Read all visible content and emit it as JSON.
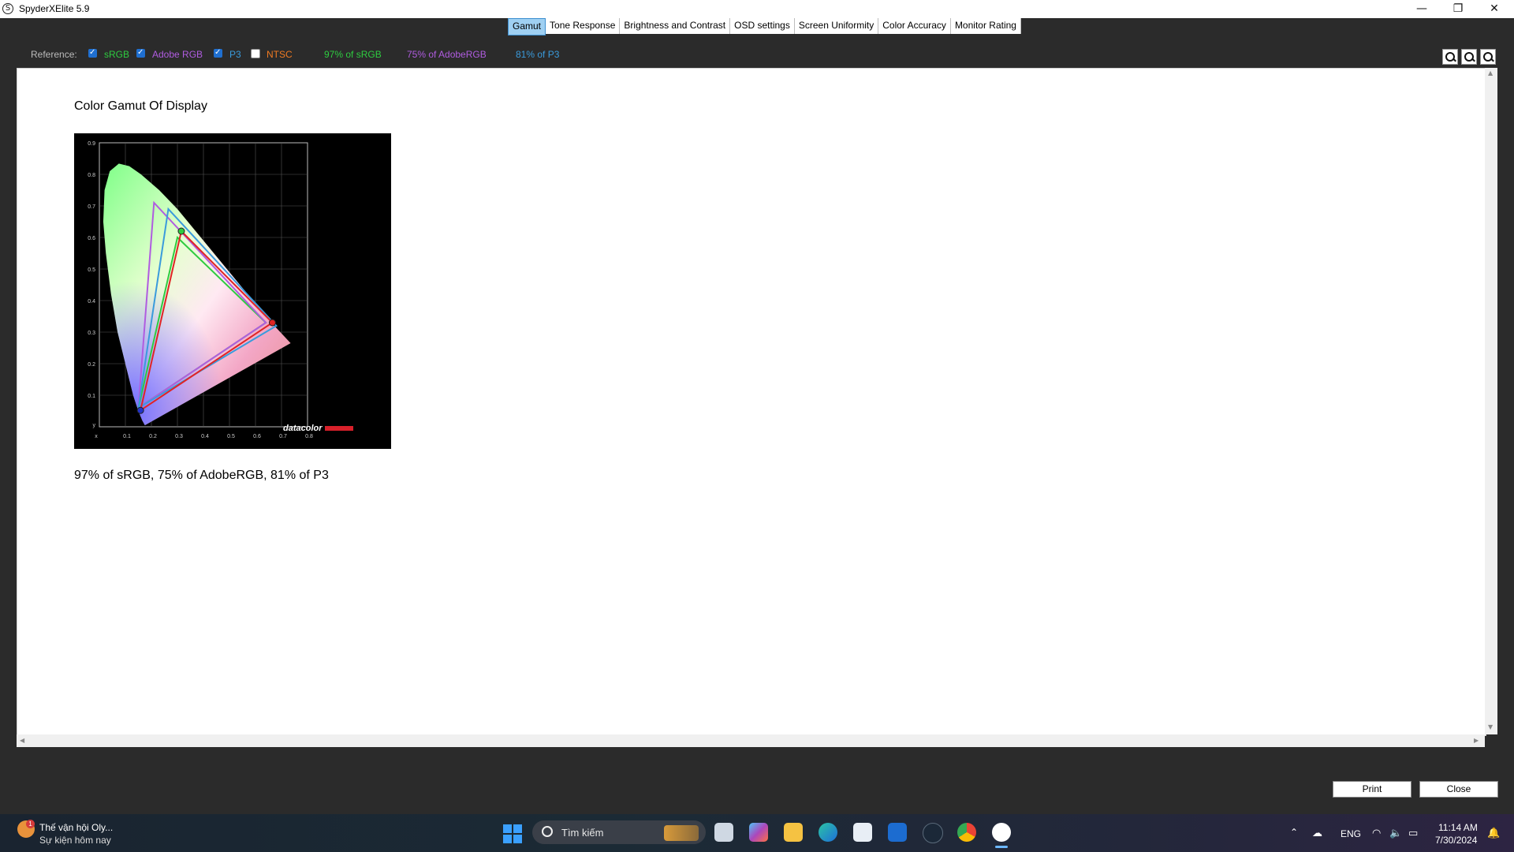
{
  "window": {
    "title": "SpyderXElite 5.9",
    "icon_glyph": "S",
    "controls": {
      "minimize": "—",
      "maximize": "❐",
      "close": "✕"
    }
  },
  "tabs": [
    {
      "label": "Gamut",
      "active": true
    },
    {
      "label": "Tone Response"
    },
    {
      "label": "Brightness and Contrast"
    },
    {
      "label": "OSD settings"
    },
    {
      "label": "Screen Uniformity"
    },
    {
      "label": "Color Accuracy"
    },
    {
      "label": "Monitor Rating"
    }
  ],
  "reference": {
    "label": "Reference:",
    "options": [
      {
        "label": "sRGB",
        "checked": true,
        "color": "#2ecc40"
      },
      {
        "label": "Adobe RGB",
        "checked": true,
        "color": "#b05ce0"
      },
      {
        "label": "P3",
        "checked": true,
        "color": "#3a9bdc"
      },
      {
        "label": "NTSC",
        "checked": false,
        "color": "#f07a22"
      }
    ],
    "stats": [
      {
        "text": "97% of sRGB",
        "color": "#2ecc40"
      },
      {
        "text": "75% of AdobeRGB",
        "color": "#b05ce0"
      },
      {
        "text": "81% of P3",
        "color": "#3a9bdc"
      }
    ]
  },
  "report": {
    "title": "Color Gamut Of Display",
    "summary": "97% of sRGB, 75% of AdobeRGB, 81% of P3"
  },
  "chart_data": {
    "type": "scatter",
    "x_ticks": [
      "x",
      "0.1",
      "0.2",
      "0.3",
      "0.4",
      "0.5",
      "0.6",
      "0.7",
      "0.8"
    ],
    "y_ticks": [
      "y",
      "0.1",
      "0.2",
      "0.3",
      "0.4",
      "0.5",
      "0.6",
      "0.7",
      "0.8",
      "0.9"
    ],
    "xlim": [
      0,
      0.8
    ],
    "ylim": [
      0,
      0.9
    ],
    "grid": true,
    "logo": "datacolor",
    "gamuts": [
      {
        "name": "sRGB",
        "color": "#2ecc40",
        "points": [
          [
            0.64,
            0.33
          ],
          [
            0.3,
            0.6
          ],
          [
            0.15,
            0.06
          ]
        ]
      },
      {
        "name": "Adobe RGB",
        "color": "#b05ce0",
        "points": [
          [
            0.64,
            0.33
          ],
          [
            0.21,
            0.71
          ],
          [
            0.15,
            0.06
          ]
        ]
      },
      {
        "name": "P3",
        "color": "#3a9bdc",
        "points": [
          [
            0.68,
            0.32
          ],
          [
            0.265,
            0.69
          ],
          [
            0.15,
            0.06
          ]
        ]
      },
      {
        "name": "Display",
        "color": "#e02424",
        "points": [
          [
            0.665,
            0.33
          ],
          [
            0.315,
            0.62
          ],
          [
            0.158,
            0.052
          ]
        ]
      }
    ],
    "locus": [
      [
        0.175,
        0.005
      ],
      [
        0.165,
        0.02
      ],
      [
        0.15,
        0.05
      ],
      [
        0.13,
        0.1
      ],
      [
        0.1,
        0.2
      ],
      [
        0.07,
        0.3
      ],
      [
        0.045,
        0.42
      ],
      [
        0.025,
        0.55
      ],
      [
        0.015,
        0.65
      ],
      [
        0.02,
        0.75
      ],
      [
        0.04,
        0.81
      ],
      [
        0.075,
        0.834
      ],
      [
        0.115,
        0.826
      ],
      [
        0.16,
        0.8
      ],
      [
        0.23,
        0.75
      ],
      [
        0.3,
        0.69
      ],
      [
        0.37,
        0.62
      ],
      [
        0.44,
        0.55
      ],
      [
        0.51,
        0.48
      ],
      [
        0.58,
        0.41
      ],
      [
        0.65,
        0.34
      ],
      [
        0.735,
        0.265
      ],
      [
        0.175,
        0.005
      ]
    ]
  },
  "buttons": {
    "print": "Print",
    "close": "Close"
  },
  "taskbar": {
    "weather_badge": "1",
    "weather_title": "Thế vận hội Oly...",
    "weather_sub": "Sự kiện hôm nay",
    "search_placeholder": "Tìm kiếm",
    "lang": "ENG",
    "time": "11:14 AM",
    "date": "7/30/2024"
  }
}
